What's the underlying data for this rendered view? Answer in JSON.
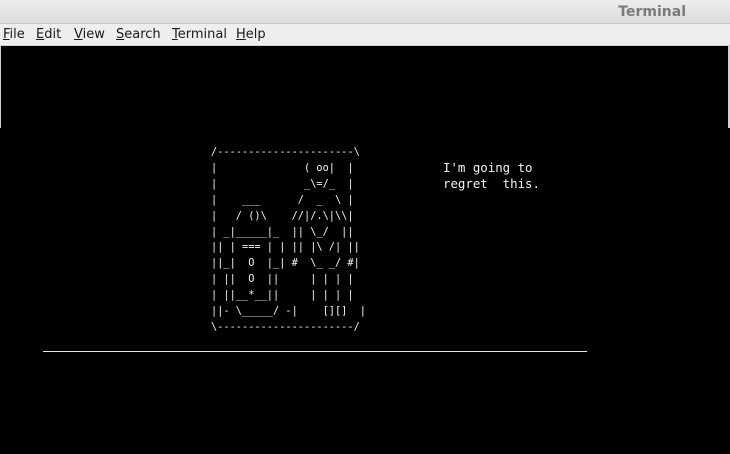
{
  "window": {
    "title": "Terminal"
  },
  "menubar": {
    "items": [
      {
        "mnemonic": "F",
        "rest": "ile"
      },
      {
        "mnemonic": "E",
        "rest": "dit"
      },
      {
        "mnemonic": "V",
        "rest": "iew"
      },
      {
        "mnemonic": "S",
        "rest": "earch"
      },
      {
        "mnemonic": "T",
        "rest": "erminal"
      },
      {
        "mnemonic": "H",
        "rest": "elp"
      }
    ]
  },
  "terminal": {
    "ascii_art": "/----------------------\\\n|              ( oo|  |\n|              _\\=/_  |\n|    ___      /  _  \\ |\n|   / ()\\    //|/.\\|\\\\|\n| _|_____|_  || \\_/  ||\n|| | === | | || |\\ /| ||\n||_|  O  |_| #  \\_ _/ #|\n| ||  O  ||     | | | |\n| ||__*__||     | | | |\n||- \\_____/ -|    [][]  |\n\\----------------------/",
    "speech": "I'm going to\nregret  this."
  }
}
